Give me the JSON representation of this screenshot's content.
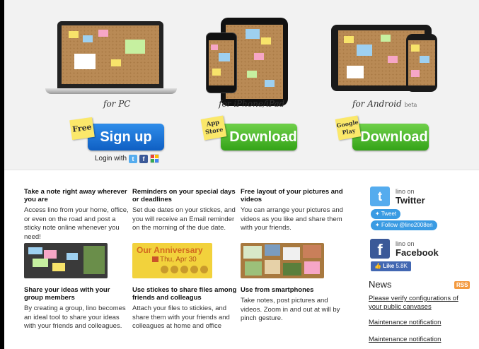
{
  "hero": {
    "pc_label": "for PC",
    "iphone_label": "for iPhone/iPad",
    "android_label": "for Android",
    "android_beta": "beta",
    "signup": {
      "badge": "Free",
      "label": "Sign up"
    },
    "appstore": {
      "badge_line1": "App",
      "badge_line2": "Store",
      "label": "Download"
    },
    "googleplay": {
      "badge_line1": "Google",
      "badge_line2": "Play",
      "label": "Download"
    },
    "login_with": "Login with"
  },
  "features": [
    {
      "title": "Take a note right away wherever you are",
      "body": "Access lino from your home, office, or even on the road and post a sticky note online whenever you need!"
    },
    {
      "title": "Reminders on your special days or deadlines",
      "body": "Set due dates on your stickes, and you will receive an Email reminder on the morning of the due date."
    },
    {
      "title": "Free layout of your pictures and videos",
      "body": "You can arrange your pictures and videos as you like and share them with your friends."
    },
    {
      "title": "Share your ideas with your group members",
      "body": "By creating a group, lino becomes an ideal tool to share your ideas with your friends and colleagues."
    },
    {
      "title": "Use stickes to share files among friends and colleagus",
      "body": "Attach your files to stickies, and share them with your friends and colleagues at home and office"
    },
    {
      "title": "Use from smartphones",
      "body": "Take notes, post pictures and videos. Zoom in and out at will by pinch gesture."
    }
  ],
  "reminder_thumb": {
    "title": "Our Anniversary",
    "date": "Thu, Apr 30"
  },
  "sidebar": {
    "twitter": {
      "prefix": "lino on",
      "name": "Twitter",
      "tweet": "Tweet",
      "follow": "Follow @lino2008en"
    },
    "facebook": {
      "prefix": "lino on",
      "name": "Facebook",
      "like": "Like",
      "like_count": "5.8K"
    },
    "news": {
      "heading": "News",
      "rss": "RSS",
      "items": [
        "Please verify configurations of your public canvases",
        "Maintenance notification",
        "Maintenance notification"
      ]
    }
  },
  "colors": {
    "twitter": "#55acee",
    "facebook": "#3b5998",
    "green": "#45b821",
    "blue": "#1a73d9",
    "rss": "#f39a40"
  }
}
